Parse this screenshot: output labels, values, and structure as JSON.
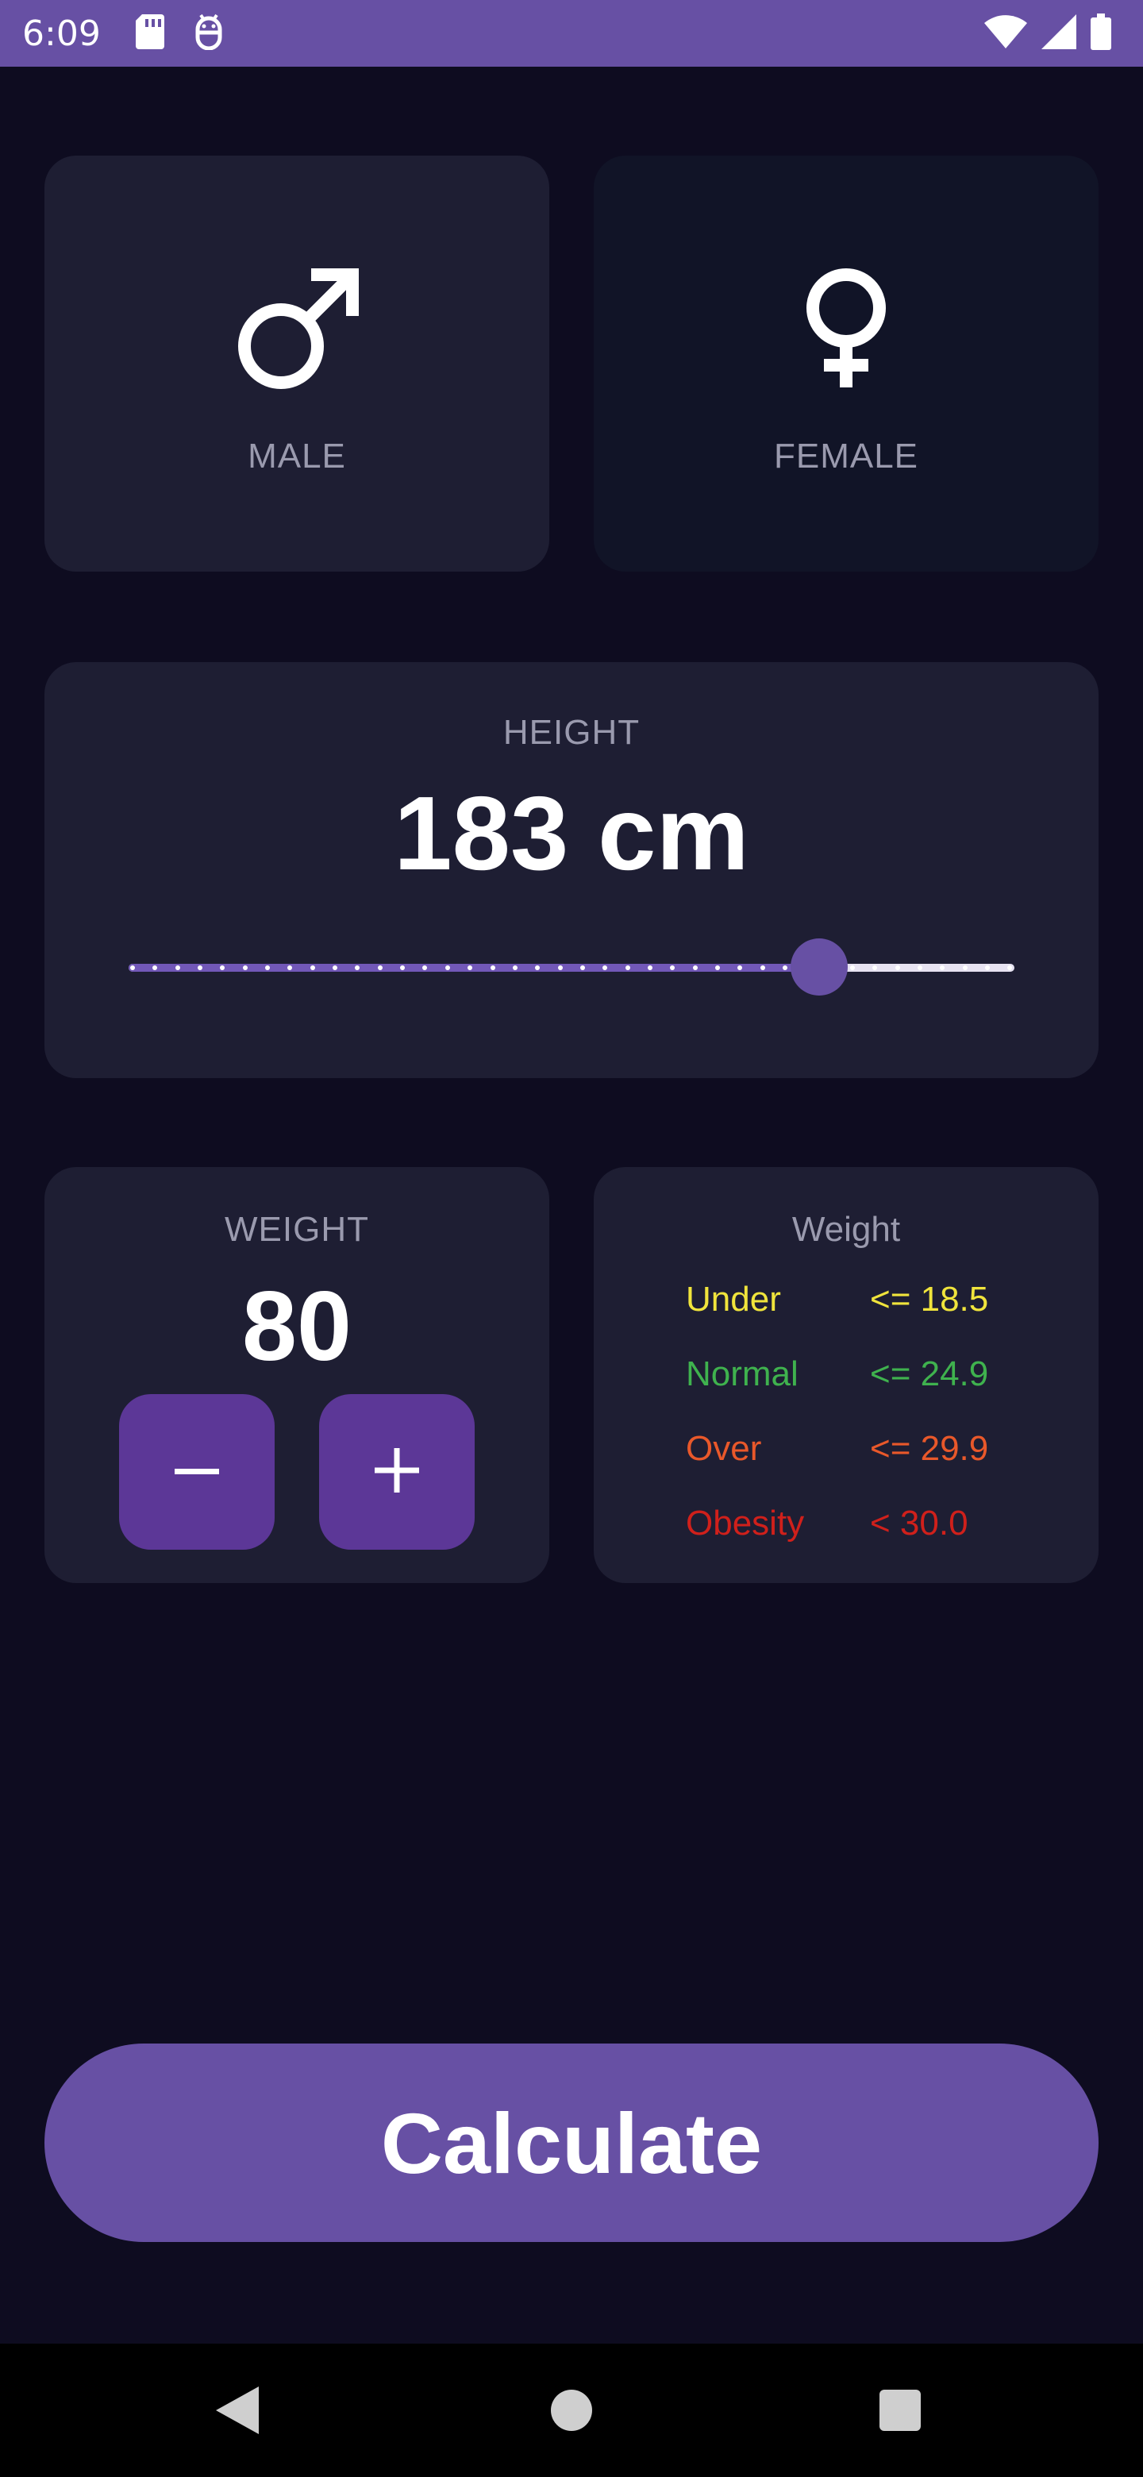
{
  "status_bar": {
    "time": "6:09",
    "left_icons": [
      "sd-card-icon",
      "android-debug-icon"
    ],
    "right_icons": [
      "wifi-icon",
      "signal-icon",
      "battery-icon"
    ]
  },
  "gender": {
    "male_label": "MALE",
    "female_label": "FEMALE",
    "selected": "MALE"
  },
  "height": {
    "label": "HEIGHT",
    "value_text": "183 cm",
    "slider_fraction": 0.78
  },
  "weight": {
    "label": "WEIGHT",
    "value": "80",
    "minus_label": "−",
    "plus_label": "+"
  },
  "legend": {
    "title": "Weight",
    "rows": [
      {
        "label": "Under",
        "value": "<= 18.5",
        "color": "#f0e43c"
      },
      {
        "label": "Normal",
        "value": "<= 24.9",
        "color": "#3fb24e"
      },
      {
        "label": "Over",
        "value": "<= 29.9",
        "color": "#e9582a"
      },
      {
        "label": "Obesity",
        "value": "< 30.0",
        "color": "#d0201b"
      }
    ]
  },
  "calculate_label": "Calculate",
  "colors": {
    "accent": "#6750a4",
    "background": "#0e0c20",
    "card_active": "#1e1e33",
    "card_inactive": "#111427",
    "step_button": "#5c3797"
  }
}
